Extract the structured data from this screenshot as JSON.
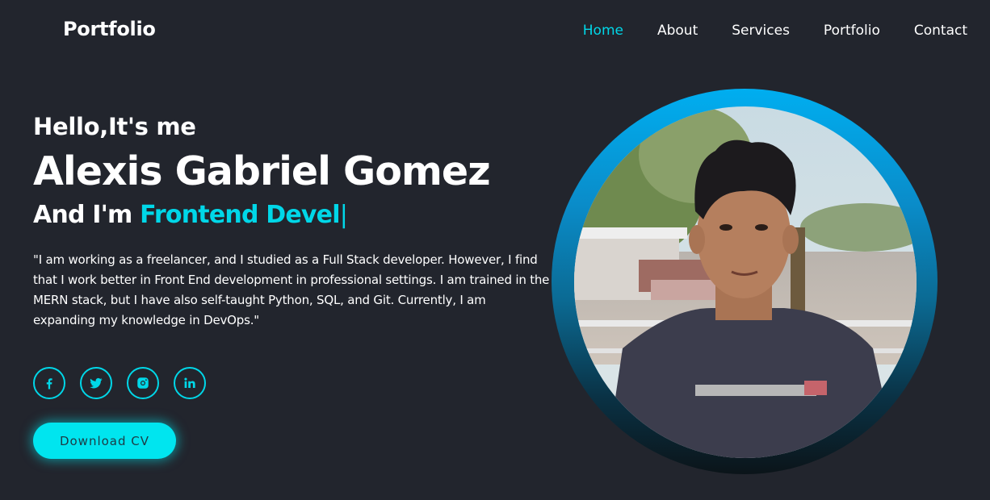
{
  "header": {
    "logo": "Portfolio",
    "nav": [
      {
        "label": "Home",
        "active": true
      },
      {
        "label": "About",
        "active": false
      },
      {
        "label": "Services",
        "active": false
      },
      {
        "label": "Portfolio",
        "active": false
      },
      {
        "label": "Contact",
        "active": false
      }
    ]
  },
  "hero": {
    "greeting": "Hello,It's me",
    "name": "Alexis Gabriel Gomez",
    "role_prefix": "And I'm ",
    "role_typed": "Frontend Devel",
    "caret": "|",
    "description": "\"I am working as a freelancer, and I studied as a Full Stack developer. However, I find that I work better in Front End development in professional settings. I am trained in the MERN stack, but I have also self-taught Python, SQL, and Git. Currently, I am expanding my knowledge in DevOps.\"",
    "cv_button": "Download CV"
  },
  "socials": [
    "facebook-icon",
    "twitter-icon",
    "instagram-icon",
    "linkedin-icon"
  ],
  "colors": {
    "background": "#22252d",
    "accent": "#00d7e8",
    "button": "#00e5ef"
  }
}
